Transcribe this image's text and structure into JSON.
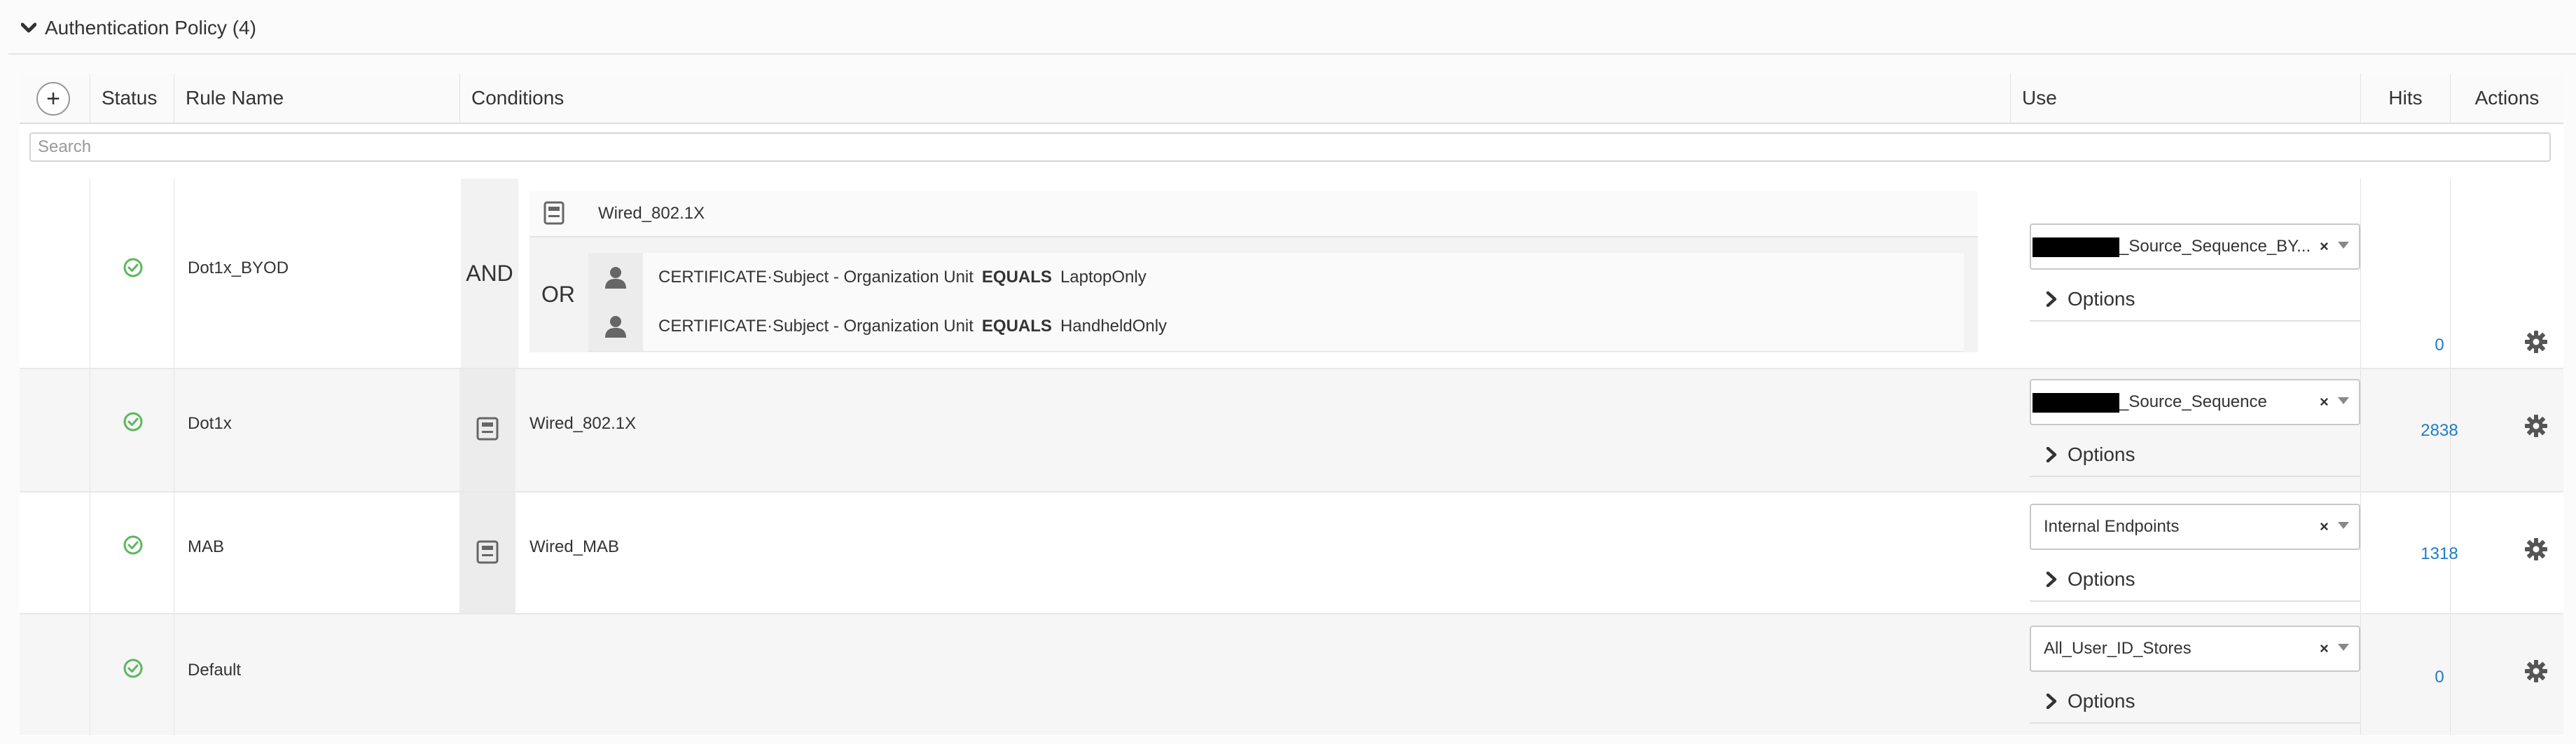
{
  "section": {
    "title": "Authentication Policy (4)",
    "expand_icon": "chevron-down-icon"
  },
  "table": {
    "columns": {
      "status": "Status",
      "rule_name": "Rule Name",
      "conditions": "Conditions",
      "use": "Use",
      "hits": "Hits",
      "actions": "Actions"
    },
    "add_button": "+",
    "search_placeholder": "Search"
  },
  "rules": [
    {
      "status_icon": "check-circle-icon",
      "name": "Dot1x_BYOD",
      "and_label": "AND",
      "condition_top": "Wired_802.1X",
      "or_label": "OR",
      "or_conditions": [
        {
          "attribute": "CERTIFICATE·Subject - Organization Unit",
          "operator": "EQUALS",
          "value": "LaptopOnly"
        },
        {
          "attribute": "CERTIFICATE·Subject - Organization Unit",
          "operator": "EQUALS",
          "value": "HandheldOnly"
        }
      ],
      "use": "_Source_Sequence_BY...",
      "use_redacted": true,
      "clear": "×",
      "options": "Options",
      "hits": "0"
    },
    {
      "status_icon": "check-circle-icon",
      "name": "Dot1x",
      "condition": "Wired_802.1X",
      "use": "_Source_Sequence",
      "use_redacted": true,
      "clear": "×",
      "options": "Options",
      "hits": "2838"
    },
    {
      "status_icon": "check-circle-icon",
      "name": "MAB",
      "condition": "Wired_MAB",
      "use": "Internal Endpoints",
      "use_redacted": false,
      "clear": "×",
      "options": "Options",
      "hits": "1318"
    },
    {
      "status_icon": "check-circle-icon",
      "name": "Default",
      "use": "All_User_ID_Stores",
      "use_redacted": false,
      "clear": "×",
      "options": "Options",
      "hits": "0"
    }
  ],
  "colors": {
    "status_green": "#5cb85c",
    "hits_link": "#1f7cc3",
    "icon_gray": "#666666"
  }
}
